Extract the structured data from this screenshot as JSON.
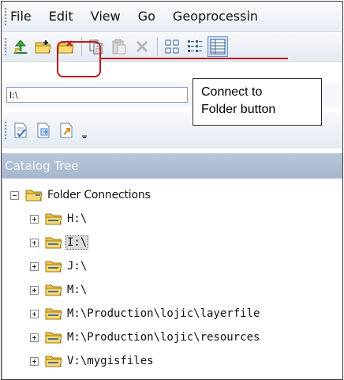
{
  "menu": {
    "items": [
      "File",
      "Edit",
      "View",
      "Go",
      "Geoprocessin"
    ]
  },
  "annotation": {
    "line1": "Connect to",
    "line2": "Folder button",
    "color": "#c11b1b"
  },
  "toolbar": {
    "buttons": [
      {
        "name": "up-one-level-icon"
      },
      {
        "name": "connect-to-folder-icon"
      },
      {
        "name": "disconnect-from-folder-icon"
      },
      {
        "name": "copy-icon"
      },
      {
        "name": "paste-icon"
      },
      {
        "name": "delete-icon"
      },
      {
        "name": "large-icons-view-icon"
      },
      {
        "name": "list-view-icon"
      },
      {
        "name": "details-view-icon"
      }
    ]
  },
  "address": {
    "value": "I:\\"
  },
  "toolbar2": {
    "buttons": [
      {
        "name": "metadata-validate-icon"
      },
      {
        "name": "metadata-import-icon"
      },
      {
        "name": "metadata-export-icon"
      }
    ]
  },
  "catalog": {
    "title": "Catalog Tree",
    "root": {
      "label": "Folder Connections",
      "expanded": true
    },
    "children": [
      {
        "label": "H:\\",
        "selected": false
      },
      {
        "label": "I:\\",
        "selected": true
      },
      {
        "label": "J:\\",
        "selected": false
      },
      {
        "label": "M:\\",
        "selected": false
      },
      {
        "label": "M:\\Production\\lojic\\layerfile",
        "selected": false
      },
      {
        "label": "M:\\Production\\lojic\\resources",
        "selected": false
      },
      {
        "label": "V:\\mygisfiles",
        "selected": false
      }
    ]
  },
  "colors": {
    "header_bg": "#a6b6cc",
    "folder_yellow": "#f2c94c",
    "selection": "#dcdcdc"
  }
}
